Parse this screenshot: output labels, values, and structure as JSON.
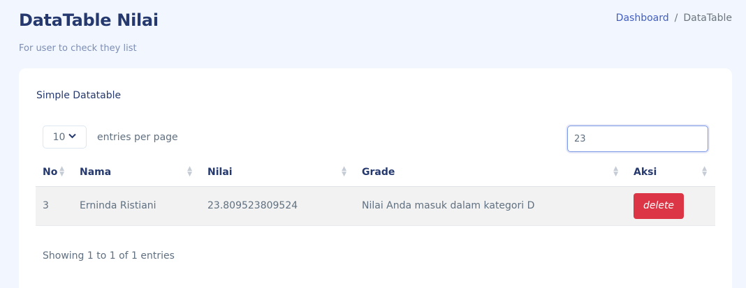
{
  "header": {
    "title": "DataTable Nilai",
    "subtitle": "For user to check they list"
  },
  "breadcrumb": {
    "home": "Dashboard",
    "separator": "/",
    "current": "DataTable"
  },
  "card": {
    "title": "Simple Datatable",
    "per_page_value": "10",
    "per_page_label": "entries per page",
    "search_value": "23",
    "columns": [
      "No",
      "Nama",
      "Nilai",
      "Grade",
      "Aksi"
    ],
    "rows": [
      {
        "no": "3",
        "nama": "Erninda Ristiani",
        "nilai": "23.809523809524",
        "grade": "Nilai Anda masuk dalam kategori D",
        "action": "delete"
      }
    ],
    "info": "Showing 1 to 1 of 1 entries"
  },
  "colors": {
    "background": "#f2f7ff",
    "primary": "#435ebe",
    "danger": "#dc3545",
    "heading": "#25396f"
  }
}
